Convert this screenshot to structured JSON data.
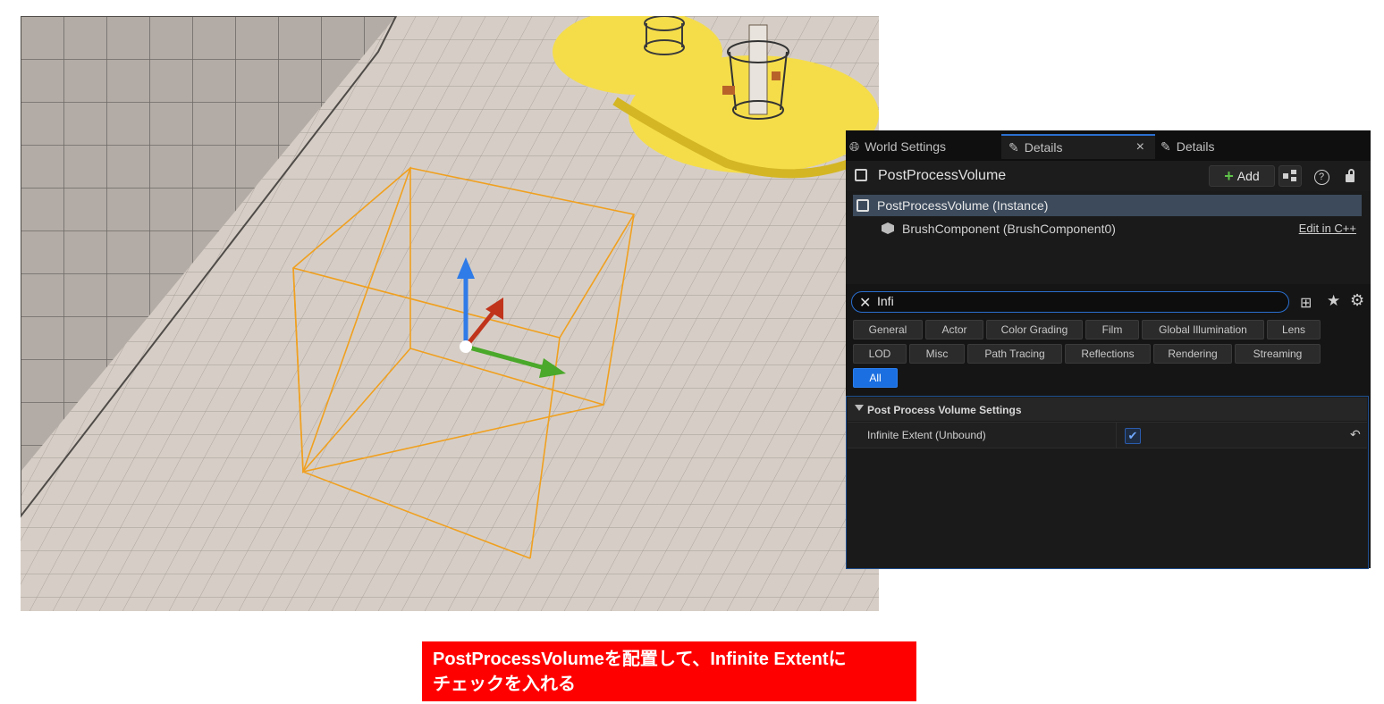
{
  "tabs": [
    {
      "label": "World Settings",
      "icon": "globe-icon"
    },
    {
      "label": "Details",
      "icon": "edit-icon",
      "close": "×"
    },
    {
      "label": "Details",
      "icon": "edit-icon"
    }
  ],
  "header": {
    "title": "PostProcessVolume",
    "add_label": "Add",
    "help_icon": "?",
    "lock_icon": "lock-icon"
  },
  "tree": {
    "instance": "PostProcessVolume (Instance)",
    "brush": "BrushComponent (BrushComponent0)",
    "edit_link": "Edit in C++"
  },
  "search": {
    "value": "Infi",
    "placeholder": ""
  },
  "filters": [
    {
      "label": "General"
    },
    {
      "label": "Actor"
    },
    {
      "label": "Color Grading"
    },
    {
      "label": "Film"
    },
    {
      "label": "Global Illumination"
    },
    {
      "label": "Lens"
    },
    {
      "label": "LOD"
    },
    {
      "label": "Misc"
    },
    {
      "label": "Path Tracing"
    },
    {
      "label": "Reflections"
    },
    {
      "label": "Rendering"
    },
    {
      "label": "Streaming"
    },
    {
      "label": "All",
      "selected": true
    }
  ],
  "section": {
    "title": "Post Process Volume Settings",
    "property_label": "Infinite Extent (Unbound)",
    "checked": true
  },
  "caption": {
    "line1": "PostProcessVolumeを配置して、Infinite Extentに",
    "line2": "チェックを入れる"
  },
  "colors": {
    "accent": "#1b6fe0",
    "caption_bg": "#ff0000",
    "selection_box": "#f0a020"
  }
}
